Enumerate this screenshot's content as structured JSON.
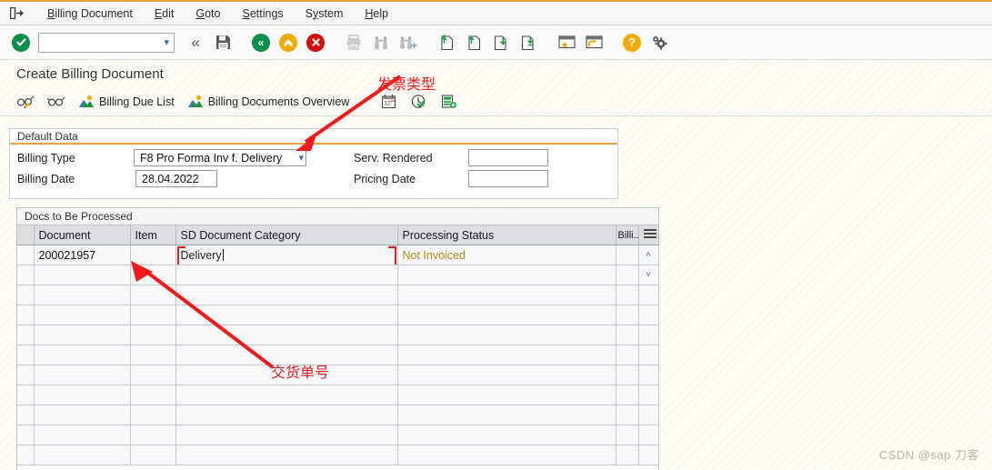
{
  "window": {
    "title": "Create Billing Document",
    "system_icon": "exit-arrow-icon"
  },
  "menubar": {
    "items": [
      {
        "label": "Billing Document",
        "accel": "B"
      },
      {
        "label": "Edit",
        "accel": "E"
      },
      {
        "label": "Goto",
        "accel": "G"
      },
      {
        "label": "Settings",
        "accel": "S"
      },
      {
        "label": "System",
        "accel": "y"
      },
      {
        "label": "Help",
        "accel": "H"
      }
    ]
  },
  "toolbar": {
    "enter_icon": "green-check-icon",
    "command_value": "",
    "command_placeholder": "",
    "command_dropdown_icon": "chevron-down-icon",
    "buttons": [
      {
        "name": "back-button",
        "icon": "double-chevron-left-icon"
      },
      {
        "name": "save-button",
        "icon": "floppy-disk-icon"
      },
      {
        "name": "exit-button",
        "icon": "green-back-circle-icon"
      },
      {
        "name": "up-button",
        "icon": "amber-up-circle-icon"
      },
      {
        "name": "cancel-button",
        "icon": "red-x-circle-icon"
      },
      {
        "name": "print-button",
        "icon": "printer-icon"
      },
      {
        "name": "find-button",
        "icon": "binoculars-icon"
      },
      {
        "name": "find-next-button",
        "icon": "binoculars-plus-icon"
      },
      {
        "name": "first-page-button",
        "icon": "page-first-icon"
      },
      {
        "name": "previous-page-button",
        "icon": "page-up-icon"
      },
      {
        "name": "next-page-button",
        "icon": "page-down-icon"
      },
      {
        "name": "last-page-button",
        "icon": "page-last-icon"
      },
      {
        "name": "favorites-button",
        "icon": "star-window-icon"
      },
      {
        "name": "new-window-button",
        "icon": "new-window-icon"
      },
      {
        "name": "help-button",
        "icon": "question-circle-icon"
      },
      {
        "name": "customize-button",
        "icon": "gear-icon"
      }
    ]
  },
  "apptoolbar": {
    "items": [
      {
        "name": "display-change-button",
        "label": "",
        "icon": "glasses-pencil-icon"
      },
      {
        "name": "display-button",
        "label": "",
        "icon": "glasses-icon"
      },
      {
        "name": "billing-due-list-button",
        "label": "Billing Due List",
        "icon": "selection-icon"
      },
      {
        "name": "billing-documents-overview-button",
        "label": "Billing Documents Overview",
        "icon": "selection-icon"
      },
      {
        "name": "billing-date-button",
        "label": "",
        "icon": "calendar-icon"
      },
      {
        "name": "pricing-date-button",
        "label": "",
        "icon": "clock-check-icon"
      },
      {
        "name": "add-item-button",
        "label": "",
        "icon": "list-add-icon"
      }
    ]
  },
  "default_data": {
    "group_title": "Default Data",
    "billing_type_label": "Billing Type",
    "billing_type_value": "F8 Pro Forma Inv f. Delivery",
    "billing_date_label": "Billing Date",
    "billing_date_value": "28.04.2022",
    "serv_rendered_label": "Serv. Rendered",
    "serv_rendered_value": "",
    "pricing_date_label": "Pricing Date",
    "pricing_date_value": ""
  },
  "docs_table": {
    "title": "Docs to Be Processed",
    "settings_icon": "table-settings-icon",
    "scroll_up_icon": "chevron-up-icon",
    "scroll_down_icon": "chevron-down-icon",
    "columns": [
      {
        "key": "document",
        "label": "Document"
      },
      {
        "key": "item",
        "label": "Item"
      },
      {
        "key": "sd_document_category",
        "label": "SD Document Category"
      },
      {
        "key": "processing_status",
        "label": "Processing Status"
      },
      {
        "key": "billing",
        "label": "Billi..."
      }
    ],
    "rows": [
      {
        "document": "200021957",
        "item": "",
        "sd_document_category": "Delivery",
        "processing_status": "Not Invoiced",
        "billing": "",
        "document_state": "filled",
        "category_focused": true
      },
      {
        "document": "",
        "item": "",
        "sd_document_category": "",
        "processing_status": "",
        "billing": "",
        "document_state": "required"
      },
      {
        "document": "",
        "item": "",
        "sd_document_category": "",
        "processing_status": "",
        "billing": "",
        "document_state": "required"
      },
      {
        "document": "",
        "item": "",
        "sd_document_category": "",
        "processing_status": "",
        "billing": "",
        "document_state": "required"
      },
      {
        "document": "",
        "item": "",
        "sd_document_category": "",
        "processing_status": "",
        "billing": "",
        "document_state": "required"
      },
      {
        "document": "",
        "item": "",
        "sd_document_category": "",
        "processing_status": "",
        "billing": "",
        "document_state": "required"
      },
      {
        "document": "",
        "item": "",
        "sd_document_category": "",
        "processing_status": "",
        "billing": "",
        "document_state": "required"
      },
      {
        "document": "",
        "item": "",
        "sd_document_category": "",
        "processing_status": "",
        "billing": "",
        "document_state": "required"
      },
      {
        "document": "",
        "item": "",
        "sd_document_category": "",
        "processing_status": "",
        "billing": "",
        "document_state": "required"
      },
      {
        "document": "",
        "item": "",
        "sd_document_category": "",
        "processing_status": "",
        "billing": "",
        "document_state": "required"
      },
      {
        "document": "",
        "item": "",
        "sd_document_category": "",
        "processing_status": "",
        "billing": "",
        "document_state": "required"
      }
    ]
  },
  "annotations": [
    {
      "name": "invoice-type-annotation",
      "text": "发票类型"
    },
    {
      "name": "delivery-number-annotation",
      "text": "交货单号"
    }
  ],
  "watermark": {
    "text": "CSDN @sap 刀客"
  },
  "colors": {
    "accent_orange": "#e8a33d",
    "required_field": "#fad790",
    "selected_cell": "#cde3f3",
    "status_text": "#b08a14",
    "annotation_red": "#ef1b1b"
  }
}
